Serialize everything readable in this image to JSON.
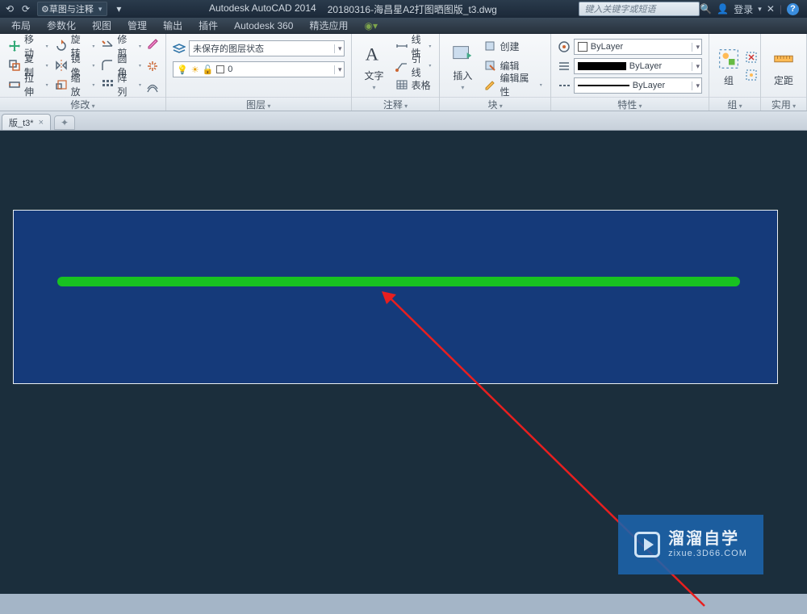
{
  "title": {
    "app": "Autodesk AutoCAD 2014",
    "file": "20180316-海昌星A2打图晒图版_t3.dwg",
    "workspace": "草图与注释",
    "search_placeholder": "键入关键字或短语",
    "login": "登录"
  },
  "menu": [
    "布局",
    "参数化",
    "视图",
    "管理",
    "输出",
    "插件",
    "Autodesk 360",
    "精选应用"
  ],
  "panels": {
    "modify": {
      "title": "修改",
      "r1": [
        "移动",
        "旋转",
        "修剪"
      ],
      "r2": [
        "复制",
        "镜像",
        "圆角"
      ],
      "r3": [
        "拉伸",
        "缩放",
        "阵列"
      ]
    },
    "layer": {
      "title": "图层",
      "state_combo": "未保存的图层状态",
      "layer_combo": "0"
    },
    "annotate": {
      "title": "注释",
      "text_btn": "文字",
      "r1": "线性",
      "r2": "引线",
      "r3": "表格"
    },
    "block": {
      "title": "块",
      "insert_btn": "插入",
      "r1": "创建",
      "r2": "编辑",
      "r3": "编辑属性"
    },
    "properties": {
      "title": "特性",
      "bylayer": "ByLayer"
    },
    "group": {
      "title": "组",
      "btn": "组"
    },
    "utility": {
      "title": "实用",
      "btn": "定距"
    }
  },
  "tab": {
    "name": "版_t3*"
  },
  "watermark": {
    "main": "溜溜自学",
    "sub": "zixue.3D66.COM"
  }
}
